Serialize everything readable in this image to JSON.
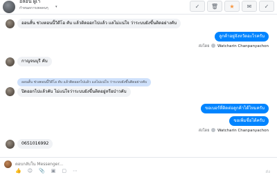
{
  "header": {
    "contact_name": "อีลอน ผูเา",
    "subtitle": "กำหนดการเพจคนๆ",
    "toolbar": [
      {
        "icon": "check-circle-icon",
        "glyph": "✓"
      },
      {
        "icon": "trash-icon",
        "glyph": "🗑"
      },
      {
        "icon": "star-icon",
        "glyph": "★"
      },
      {
        "icon": "mail-icon",
        "glyph": "✉"
      },
      {
        "icon": "checkmark-icon",
        "glyph": "✓"
      }
    ]
  },
  "messages": [
    {
      "text": "ออนสั้น ช่วงตอนนี้วิดีโอ คับ แล้วติดออกไปแล้ว แลไม่แน่ใจ ว่าระบบยังขึ้นติดอย่างคับ"
    },
    {
      "text": "ลูกค้าอยู่จังหวัดอะไรครับ"
    },
    {
      "sent_by_prefix": "ส่งโดย",
      "sent_by_name": "Watcharin Chanpanyachon"
    },
    {
      "text": "กาญจนบุรี คับ"
    },
    {
      "quote": "ออนสั้น ช่วงตอนนี้วิดีโอ คับ แล้วติดออกไปแล้ว แลไม่แน่ใจ ว่าระบบยังขึ้นติดอย่างคับ"
    },
    {
      "text": "ปิดออกไปแล้วคับ ไม่แน่ใจว่าระบบยังขึ้นติดอยู่หรือป่าวคับ"
    },
    {
      "text": "ขอเบอร์ที่ติดต่อลูกค้าได้ไหมครับ"
    },
    {
      "text": "ขอเพิ่มชื่อได้ครับ"
    },
    {
      "sent_by_prefix": "ส่งโดย",
      "sent_by_name": "Watcharin Chanpanyachon"
    },
    {
      "text": "0651016992"
    }
  ],
  "composer": {
    "placeholder": "ตอบกลับใน Messenger...",
    "send_label": "ส่ง",
    "icons": [
      {
        "name": "thumbs-up-icon",
        "glyph": "👍"
      },
      {
        "name": "emoji-icon",
        "glyph": "☺"
      },
      {
        "name": "attachment-icon",
        "glyph": "📎"
      },
      {
        "name": "image-icon",
        "glyph": "▣"
      },
      {
        "name": "gif-icon",
        "glyph": "▢"
      },
      {
        "name": "more-icon",
        "glyph": "⋯"
      }
    ]
  },
  "colors": {
    "outgoing_bubble": "#0084ff",
    "incoming_bubble": "#f0f2f5",
    "quote_bubble": "#cfe1fb",
    "star": "#f7923a"
  }
}
